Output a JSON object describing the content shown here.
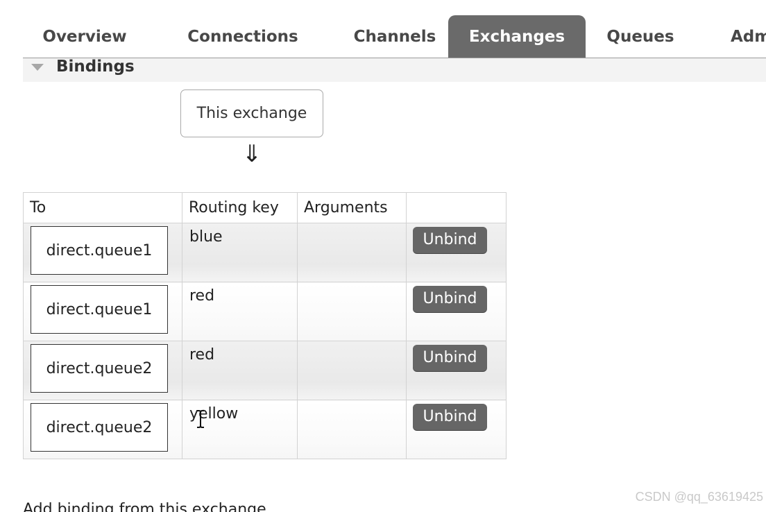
{
  "nav": {
    "tabs": [
      {
        "label": "Overview",
        "active": false
      },
      {
        "label": "Connections",
        "active": false
      },
      {
        "label": "Channels",
        "active": false
      },
      {
        "label": "Exchanges",
        "active": true
      },
      {
        "label": "Queues",
        "active": false
      },
      {
        "label": "Adm",
        "active": false
      }
    ]
  },
  "section": {
    "title": "Bindings"
  },
  "source": {
    "label": "This exchange",
    "arrow": "⇓"
  },
  "table": {
    "headers": {
      "to": "To",
      "routing_key": "Routing key",
      "arguments": "Arguments",
      "actions": ""
    },
    "rows": [
      {
        "to": "direct.queue1",
        "routing_key": "blue",
        "arguments": "",
        "action": "Unbind"
      },
      {
        "to": "direct.queue1",
        "routing_key": "red",
        "arguments": "",
        "action": "Unbind"
      },
      {
        "to": "direct.queue2",
        "routing_key": "red",
        "arguments": "",
        "action": "Unbind"
      },
      {
        "to": "direct.queue2",
        "routing_key": "yellow",
        "arguments": "",
        "action": "Unbind"
      }
    ]
  },
  "footer": {
    "add_binding_heading": "Add binding from this exchange"
  },
  "watermark": "CSDN @qq_63619425",
  "colors": {
    "active_tab": "#6a6a6a",
    "button": "#666666",
    "row_odd": "#ececec",
    "row_even": "#fafafa"
  }
}
